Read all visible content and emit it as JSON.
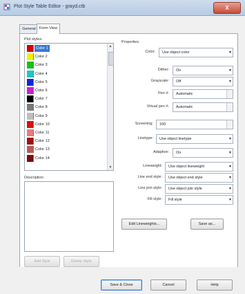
{
  "window": {
    "title": "Plot Style Table Editor - grayd.ctb",
    "close_label": "X"
  },
  "tabs": [
    {
      "label": "General"
    },
    {
      "label": "Form View"
    }
  ],
  "plot_styles": {
    "label": "Plot styles:",
    "items": [
      {
        "label": "Color 1",
        "color": "#d40000"
      },
      {
        "label": "Color 2",
        "color": "#f2f200"
      },
      {
        "label": "Color 3",
        "color": "#17c017"
      },
      {
        "label": "Color 4",
        "color": "#1ec6c6"
      },
      {
        "label": "Color 5",
        "color": "#1028d8"
      },
      {
        "label": "Color 6",
        "color": "#d21ed2"
      },
      {
        "label": "Color 7",
        "color": "#000000"
      },
      {
        "label": "Color 8",
        "color": "#7a7a7a"
      },
      {
        "label": "Color 9",
        "color": "#bfbfbf"
      },
      {
        "label": "Color 10",
        "color": "#d61010"
      },
      {
        "label": "Color 11",
        "color": "#e87b7b"
      },
      {
        "label": "Color 12",
        "color": "#a01010"
      },
      {
        "label": "Color 13",
        "color": "#b85a5a"
      },
      {
        "label": "Color 14",
        "color": "#7a0c0c"
      }
    ],
    "selected_index": 0
  },
  "description": {
    "label": "Description:"
  },
  "buttons": {
    "add_style": "Add Style",
    "delete_style": "Delete Style",
    "edit_lineweights": "Edit Lineweights...",
    "save_as": "Save as...",
    "save_close": "Save & Close",
    "cancel": "Cancel",
    "help": "Help"
  },
  "properties": {
    "header": "Properties",
    "color": {
      "label": "Color:",
      "value": "Use object color"
    },
    "dither": {
      "label": "Dither:",
      "value": "On"
    },
    "grayscale": {
      "label": "Grayscale:",
      "value": "Off"
    },
    "pen": {
      "label": "Pen #:",
      "value": "Automatic"
    },
    "virtual_pen": {
      "label": "Virtual pen #:",
      "value": "Automatic"
    },
    "screening": {
      "label": "Screening:",
      "value": "100"
    },
    "linetype": {
      "label": "Linetype:",
      "value": "Use object linetype"
    },
    "adaptive": {
      "label": "Adaptive:",
      "value": "On"
    },
    "lineweight": {
      "label": "Lineweight:",
      "value": "Use object lineweight"
    },
    "line_end": {
      "label": "Line end style:",
      "value": "Use object end style"
    },
    "line_join": {
      "label": "Line join style:",
      "value": "Use object join style"
    },
    "fill": {
      "label": "Fill style:",
      "value": "Fill style"
    }
  },
  "icons": {
    "app": "plot-style-app-icon",
    "dropdown": "chevron-down-icon",
    "spinner": "spinner-icon"
  }
}
